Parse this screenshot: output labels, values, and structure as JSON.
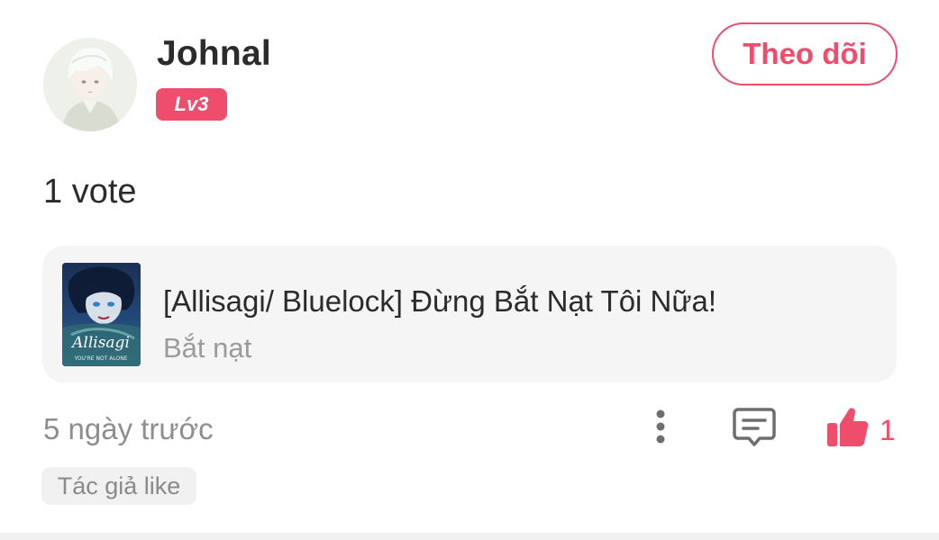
{
  "post": {
    "user": {
      "name": "Johnal",
      "level": "Lv3",
      "avatar": "avatar-portrait"
    },
    "follow_label": "Theo dõi",
    "vote_text": "1 vote",
    "story": {
      "title": "[Allisagi/ Bluelock] Đừng Bắt Nạt Tôi Nữa!",
      "tag": "Bắt nạt",
      "cover_text": "Allisagi",
      "cover_subtext": "YOU'RE NOT ALONE"
    },
    "timestamp": "5 ngày trước",
    "like_count": "1",
    "author_like_label": "Tác giả like",
    "icons": {
      "more": "more-vertical-icon",
      "comment": "comment-icon",
      "like": "thumbs-up-icon"
    },
    "colors": {
      "accent": "#ee4d6b",
      "card_bg": "#f5f5f5",
      "muted_text": "#8e8e8e"
    }
  }
}
